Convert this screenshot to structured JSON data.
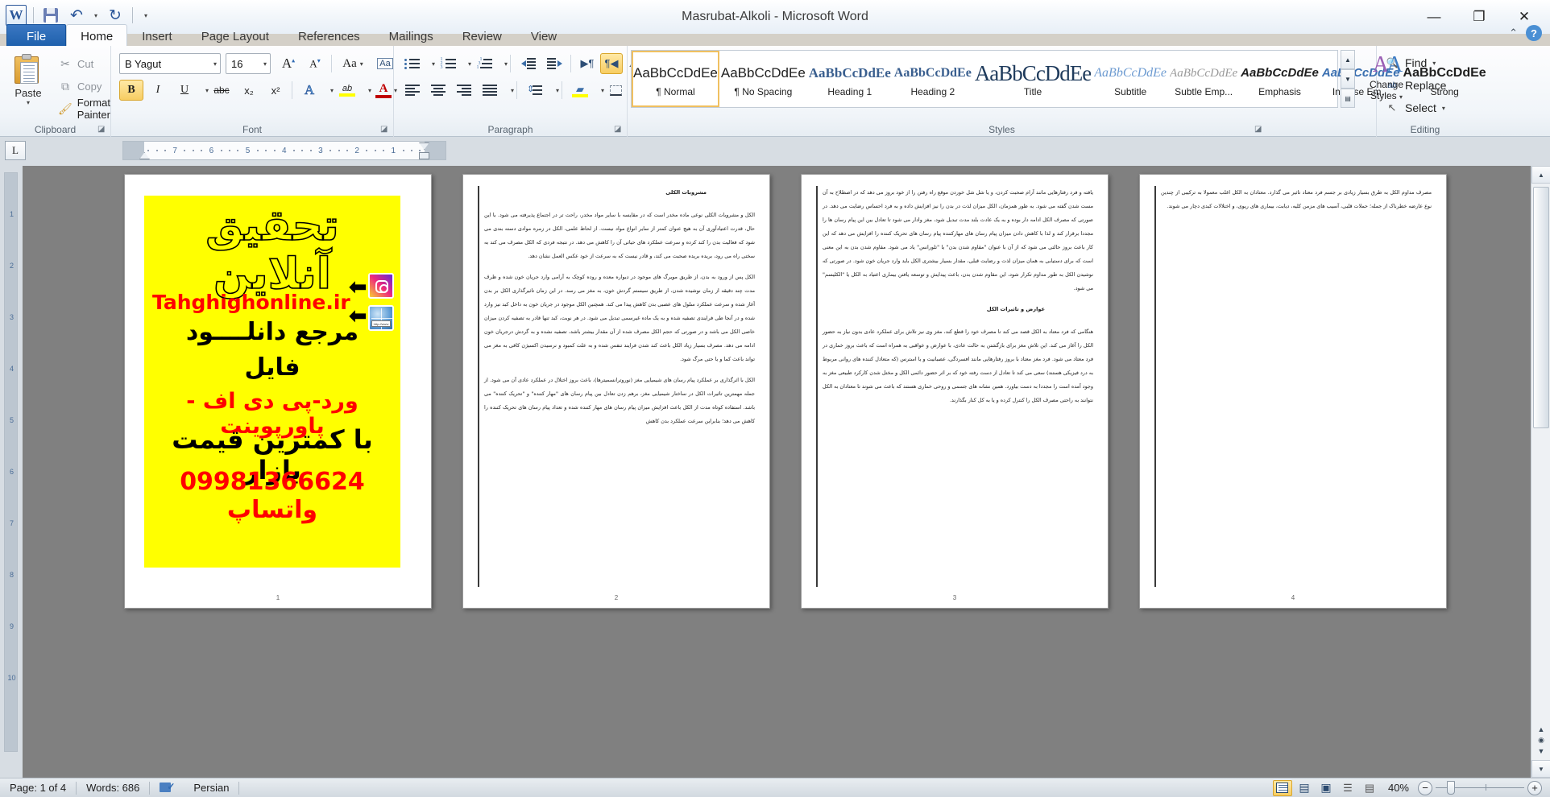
{
  "window": {
    "title": "Masrubat-Alkoli  -  Microsoft Word",
    "minimize": "—",
    "restore": "❐",
    "close": "✕"
  },
  "quick_access": {
    "word_logo": "W",
    "save": "save-icon",
    "undo": "↶",
    "undo_caret": "▾",
    "redo": "↻",
    "customize_caret": "▾"
  },
  "help": {
    "minimize_ribbon": "⌃",
    "help": "?"
  },
  "tabs": [
    {
      "label": "File",
      "active": false,
      "file": true
    },
    {
      "label": "Home",
      "active": true
    },
    {
      "label": "Insert",
      "active": false
    },
    {
      "label": "Page Layout",
      "active": false
    },
    {
      "label": "References",
      "active": false
    },
    {
      "label": "Mailings",
      "active": false
    },
    {
      "label": "Review",
      "active": false
    },
    {
      "label": "View",
      "active": false
    }
  ],
  "ribbon": {
    "clipboard": {
      "group_label": "Clipboard",
      "paste_label": "Paste",
      "paste_caret": "▾",
      "cut_label": "Cut",
      "cut_icon": "✂",
      "copy_label": "Copy",
      "copy_icon": "⧉",
      "format_painter_label": "Format Painter",
      "format_painter_icon": "🖌"
    },
    "font": {
      "group_label": "Font",
      "font_name": "B Yagut",
      "font_size": "16",
      "grow_font": "A",
      "shrink_font": "A",
      "change_case": "Aa",
      "clear_formatting": "Aa",
      "bold": "B",
      "italic": "I",
      "underline": "U",
      "strikethrough": "abc",
      "subscript": "x₂",
      "superscript": "x²",
      "text_effects": "A",
      "highlight": "ab",
      "font_color": "A",
      "caret": "▾"
    },
    "paragraph": {
      "group_label": "Paragraph",
      "bullets": "bullet-list-icon",
      "numbering": "numbered-list-icon",
      "multilevel": "multilevel-list-icon",
      "decrease_indent": "decrease-indent-icon",
      "increase_indent": "increase-indent-icon",
      "ltr_text": "▶¶",
      "rtl_text": "¶◀",
      "sort": "A↓",
      "show_marks": "¶",
      "align_left": "align-left-icon",
      "align_center": "align-center-icon",
      "align_right": "align-right-icon",
      "justify": "justify-icon",
      "line_spacing": "line-spacing-icon",
      "shading": "shading-icon",
      "borders": "borders-icon",
      "caret": "▾"
    },
    "styles": {
      "group_label": "Styles",
      "items": [
        {
          "preview": "AaBbCcDdEe",
          "name": "¶ Normal",
          "selected": true,
          "style": "normal"
        },
        {
          "preview": "AaBbCcDdEe",
          "name": "¶ No Spacing",
          "selected": false,
          "style": "normal"
        },
        {
          "preview": "AaBbCcDdEe",
          "name": "Heading 1",
          "selected": false,
          "style": "h1"
        },
        {
          "preview": "AaBbCcDdEe",
          "name": "Heading 2",
          "selected": false,
          "style": "h2"
        },
        {
          "preview": "AaBbCcDdEe",
          "name": "Title",
          "selected": false,
          "style": "title"
        },
        {
          "preview": "AaBbCcDdEe",
          "name": "Subtitle",
          "selected": false,
          "style": "subtitle"
        },
        {
          "preview": "AaBbCcDdEe",
          "name": "Subtle Emp...",
          "selected": false,
          "style": "subtle"
        },
        {
          "preview": "AaBbCcDdEe",
          "name": "Emphasis",
          "selected": false,
          "style": "emph"
        },
        {
          "preview": "AaBbCcDdEe",
          "name": "Intense Em...",
          "selected": false,
          "style": "intense"
        },
        {
          "preview": "AaBbCcDdEe",
          "name": "Strong",
          "selected": false,
          "style": "strong"
        }
      ],
      "scroll_up": "▲",
      "scroll_down": "▼",
      "more": "▤",
      "change_styles_label": "Change",
      "change_styles_label2": "Styles",
      "change_styles_caret": "▾"
    },
    "editing": {
      "group_label": "Editing",
      "find_label": "Find",
      "find_icon": "🔍",
      "find_caret": "▾",
      "replace_label": "Replace",
      "replace_icon": "ab",
      "select_label": "Select",
      "select_icon": "↖",
      "select_caret": "▾"
    }
  },
  "ruler": {
    "tab_selector": "L",
    "h_ticks": [
      "7",
      "6",
      "5",
      "4",
      "3",
      "2",
      "1"
    ],
    "v_ticks": [
      "1",
      "2",
      "3",
      "4",
      "5",
      "6",
      "7",
      "8",
      "9",
      "10"
    ]
  },
  "document": {
    "ad": {
      "title_line": "تحقیق آنلاین",
      "url": "Tahghighonline.ir",
      "instagram_icon": "instagram-icon",
      "globe_icon": "globe-icon",
      "arrow1": "⬅",
      "arrow2": "⬅",
      "line1": "مرجع دانلــــود",
      "line2": "فایل",
      "line3": "ورد-پی دی اف - پاورپوینت",
      "line4": "با کمترین قیمت بازار",
      "line5": "09981366624 واتساپ"
    },
    "pages": [
      {
        "number": "1",
        "has_image": true,
        "paragraphs": []
      },
      {
        "number": "2",
        "has_image": false,
        "paragraphs": [
          {
            "heading": true,
            "text": "مشروبات الکلی"
          },
          {
            "heading": false,
            "text": "الکل و مشروبات الکلی نوعی ماده مخدر است که در مقایسه با سایر مواد مخدر، راحت تر در اجتماع پذیرفته می شود. با این حال، قدرت اعتیادآوری آن به هیچ عنوان کمتر از سایر انواع مواد نیست. از لحاظ علمی، الکل در زمره موادی دسته بندی می شود که فعالیت بدن را کند کرده و سرعت عملکرد های حیاتی آن را کاهش می دهد. در نتیجه فردی که الکل مصرف می کند به سختی راه می رود، بریده بریده صحبت می کند، و قادر نیست که به سرعت از خود عکس العمل نشان دهد."
          },
          {
            "heading": false,
            "text": "الکل پس از ورود به بدن، از طریق مویرگ های موجود در دیواره معده و روده کوچک به آرامی وارد جریان خون شده و ظرف مدت چند دقیقه از زمان نوشیده شدن، از طریق سیستم گردش خون، به مغز می رسد. در این زمان تاثیرگذاری الکل بر بدن آغاز شده و سرعت عملکرد سلول های عصبی بدن کاهش پیدا می کند. همچنین الکل موجود در جریان خون به داخل کبد نیز وارد شده و در آنجا طی فرایندی تصفیه شده و به یک ماده غیرسمی تبدیل می شود. در هر نوبت، کبد تنها قادر به تصفیه کردن میزان خاصی الکل می باشد و در صورتی که حجم الکل مصرف شده از آن مقدار بیشتر باشد، تصفیه نشده و به گردش درجریان خون ادامه می دهد. مصرف بسیار زیاد الکل باعث کند شدن فرایند تنفس شده و به علت کمبود و نرسیدن اکسیژن کافی به مغز می تواند باعث کما و یا حتی مرگ شود."
          },
          {
            "heading": false,
            "text": "الکل با اثرگذاری بر عملکرد پیام رسان های شیمیایی مغز (نوروترانسمیترها)، باعث بروز اختلال در عملکرد عادی آن می شود. از جمله مهمترین تاثیرات الکل در ساختار شیمیایی مغز، برهم زدن تعادل بین پیام رسان های \"مهار کننده\" و \"تحریک کننده\" می باشد. استفاده کوتاه مدت از الکل باعث افزایش میزان پیام رسان های مهار کننده شده و تعداد پیام رسان های تحریک کننده را کاهش می دهد؛ بنابراین سرعت عملکرد بدن کاهش"
          }
        ]
      },
      {
        "number": "3",
        "has_image": false,
        "paragraphs": [
          {
            "heading": false,
            "text": "یافته و فرد رفتارهایی مانند آرام صحبت کردن، و یا شل شل خوردن موقع راه رفتن را از خود بروز می دهد که در اصطلاح به آن مست شدن گفته می شود. به طور همزمان، الکل میزان لذت در بدن را نیز افزایش داده و به فرد احساس رضایت می دهد. در صورتی که مصرف الکل ادامه دار بوده و به یک عادت بلند مدت تبدیل شود، مغز وادار می شود تا تعادل بین این پیام رسان ها را مجددا برقرار کند و لذا با کاهش دادن میزان پیام رسان های مهارکننده پیام رسان های تحریک کننده را افزایش می دهد که این کار باعث بروز حالتی می شود که از آن با عنوان \"مقاوم شدن بدن\" یا \"تلورانس\" یاد می شود. مقاوم شدن بدن به این معنی است که برای دستیابی به همان میزان لذت و رضایت قبلی، مقدار بسیار بیشتری الکل باید وارد جریان خون شود. در صورتی که نوشیدن الکل به طور مداوم تکرار شود، این مقاوم شدن بدن، باعث پیدایش و توسعه یافتن بیماری اعتیاد به الکل یا \"الکلیسم\" می شود."
          },
          {
            "heading": true,
            "text": "عوارض و تاثیرات الکل"
          },
          {
            "heading": false,
            "text": "هنگامی که فرد معتاد به الکل قصد می کند تا مصرف خود را قطع کند، مغز وی نیز تلاش برای عملکرد عادی بدون نیاز به حضور الکل را آغاز می کند. این تلاش مغز برای بازگشتن به حالت عادی، با عوارض و عواقبی به همراه است که باعث بروز خماری در فرد معتاد می شود. فرد مغز معتاد با بروز رفتارهایی مانند افسردگی، عصبانیت و یا استرس (که متعادل کننده های روانی مربوط به درد فیزیکی هستند) سعی می کند تا تعادل از دست رفته خود که بر اثر حضور دائمی الکل و مختل شدن کارکرد طبیعی مغز به وجود آمده است را مجددا به دست بیاورد. همین نشانه های جسمی و روحی خماری هستند که باعث می شوند تا معتادان به الکل نتوانند به راحتی مصرف الکل را کنترل کرده و یا به کل کنار بگذارند."
          }
        ]
      },
      {
        "number": "4",
        "has_image": false,
        "paragraphs": [
          {
            "heading": false,
            "text": "مصرف مداوم الکل به طرق بسیار زیادی بر جسم فرد معتاد تاثیر می گذارد. معتادان به الکل اغلب معمولا به ترکیبی از چندین نوع عارضه خطرناک از جمله؛ حملات قلبی، آسیب های مزمن کلیه، دیابت، بیماری های ریوی، و اختلالات کبدی دچار می شوند."
          }
        ]
      }
    ]
  },
  "statusbar": {
    "page": "Page: 1 of 4",
    "words": "Words: 686",
    "spell_icon": "spell-check-icon",
    "language": "Persian",
    "views": [
      {
        "name": "print-layout",
        "active": true
      },
      {
        "name": "full-screen-reading",
        "active": false
      },
      {
        "name": "web-layout",
        "active": false
      },
      {
        "name": "outline",
        "active": false
      },
      {
        "name": "draft",
        "active": false
      }
    ],
    "zoom": "40%",
    "zoom_out": "−",
    "zoom_in": "+"
  },
  "colors": {
    "accent": "#2a5699",
    "highlight": "#f7cd62",
    "ad_bg": "#ffff00",
    "ad_red": "#ff0000"
  }
}
